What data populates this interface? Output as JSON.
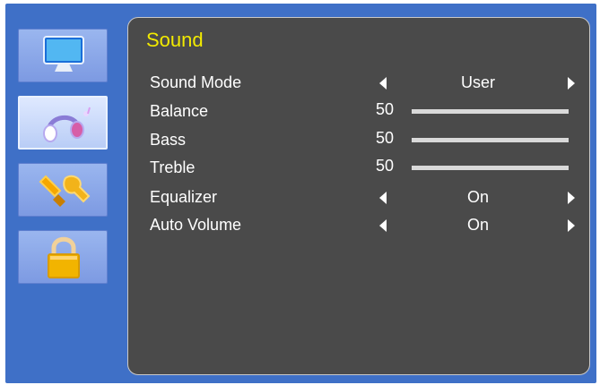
{
  "sidebar": {
    "items": [
      {
        "name": "picture",
        "icon": "monitor-icon",
        "active": false
      },
      {
        "name": "sound",
        "icon": "headphones-icon",
        "active": true
      },
      {
        "name": "setup",
        "icon": "tools-icon",
        "active": false
      },
      {
        "name": "lock",
        "icon": "padlock-icon",
        "active": false
      }
    ]
  },
  "panel": {
    "title": "Sound",
    "rows": [
      {
        "label": "Sound Mode",
        "type": "select",
        "value": "User"
      },
      {
        "label": "Balance",
        "type": "slider",
        "value": "50",
        "level": 1.0
      },
      {
        "label": "Bass",
        "type": "slider",
        "value": "50",
        "level": 1.0
      },
      {
        "label": "Treble",
        "type": "slider",
        "value": "50",
        "level": 1.0
      },
      {
        "label": "Equalizer",
        "type": "select",
        "value": "On"
      },
      {
        "label": "Auto Volume",
        "type": "select",
        "value": "On"
      }
    ]
  },
  "colors": {
    "background": "#3f70c7",
    "panel": "#4a4a4a",
    "title": "#f2ea00",
    "text": "#ffffff"
  }
}
